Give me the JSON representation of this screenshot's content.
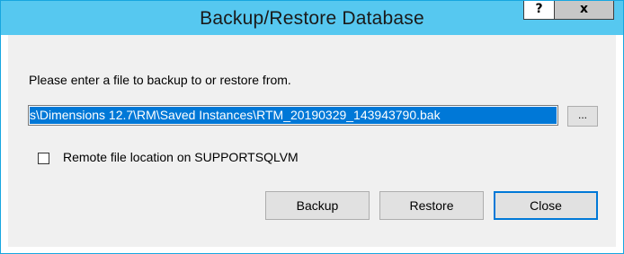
{
  "window": {
    "title": "Backup/Restore Database",
    "help_label": "?",
    "close_label": "x"
  },
  "dialog": {
    "prompt": "Please enter a file to backup to or restore from.",
    "file_path_visible": "s\\Dimensions 12.7\\RM\\Saved Instances\\RTM_20190329_143943790.bak",
    "browse_label": "...",
    "remote_checkbox_label": "Remote file location on SUPPORTSQLVM",
    "remote_checked": false
  },
  "buttons": {
    "backup_label": "Backup",
    "restore_label": "Restore",
    "close_label": "Close"
  },
  "colors": {
    "titlebar": "#56c8f0",
    "border": "#17a6e0",
    "selection": "#0078d7",
    "client_bg": "#f0f0f0"
  }
}
